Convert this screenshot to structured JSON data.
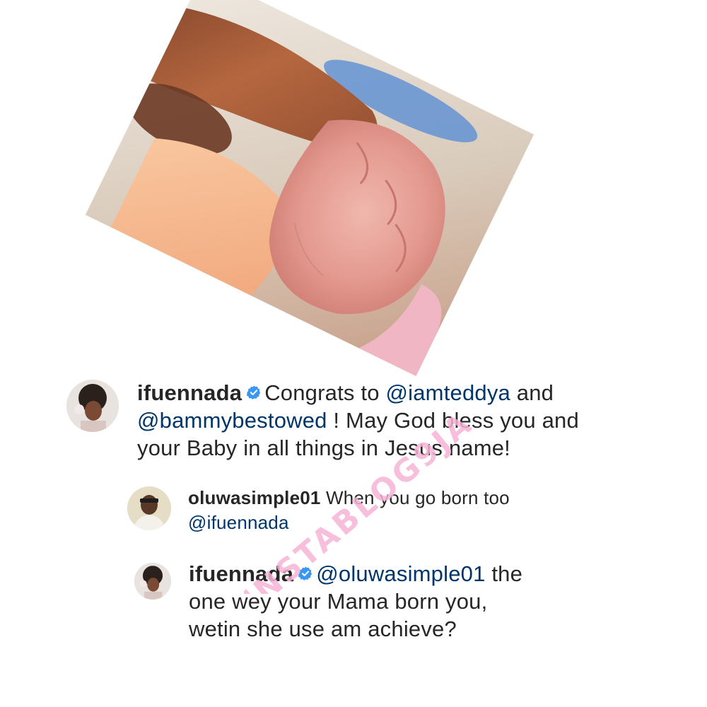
{
  "photo": {
    "subject": "newborn-hand-holding-finger"
  },
  "comments": [
    {
      "username": "ifuennada",
      "verified": true,
      "segments": [
        {
          "type": "text",
          "value": "Congrats to "
        },
        {
          "type": "mention",
          "value": "@iamteddya"
        },
        {
          "type": "text",
          "value": " and"
        },
        {
          "type": "mention",
          "value": "@bammybestowed"
        },
        {
          "type": "text",
          "value": " ! May God bless you and"
        },
        {
          "type": "text",
          "value": "your Baby in all things in Jesus name!"
        }
      ]
    },
    {
      "username": "oluwasimple01",
      "verified": false,
      "segments": [
        {
          "type": "text",
          "value": "When you go born too"
        },
        {
          "type": "mention",
          "value": "@ifuennada"
        }
      ]
    },
    {
      "username": "ifuennada",
      "verified": true,
      "segments": [
        {
          "type": "mention",
          "value": "@oluwasimple01"
        },
        {
          "type": "text",
          "value": " the"
        },
        {
          "type": "text",
          "value": "one wey your Mama born you,"
        },
        {
          "type": "text",
          "value": "wetin she use am achieve?"
        }
      ]
    }
  ],
  "watermark": {
    "text": "INSTABLOG9JA",
    "color": "#f7b4d6"
  },
  "colors": {
    "text": "#262626",
    "mention": "#003569",
    "verified": "#3897f0"
  }
}
